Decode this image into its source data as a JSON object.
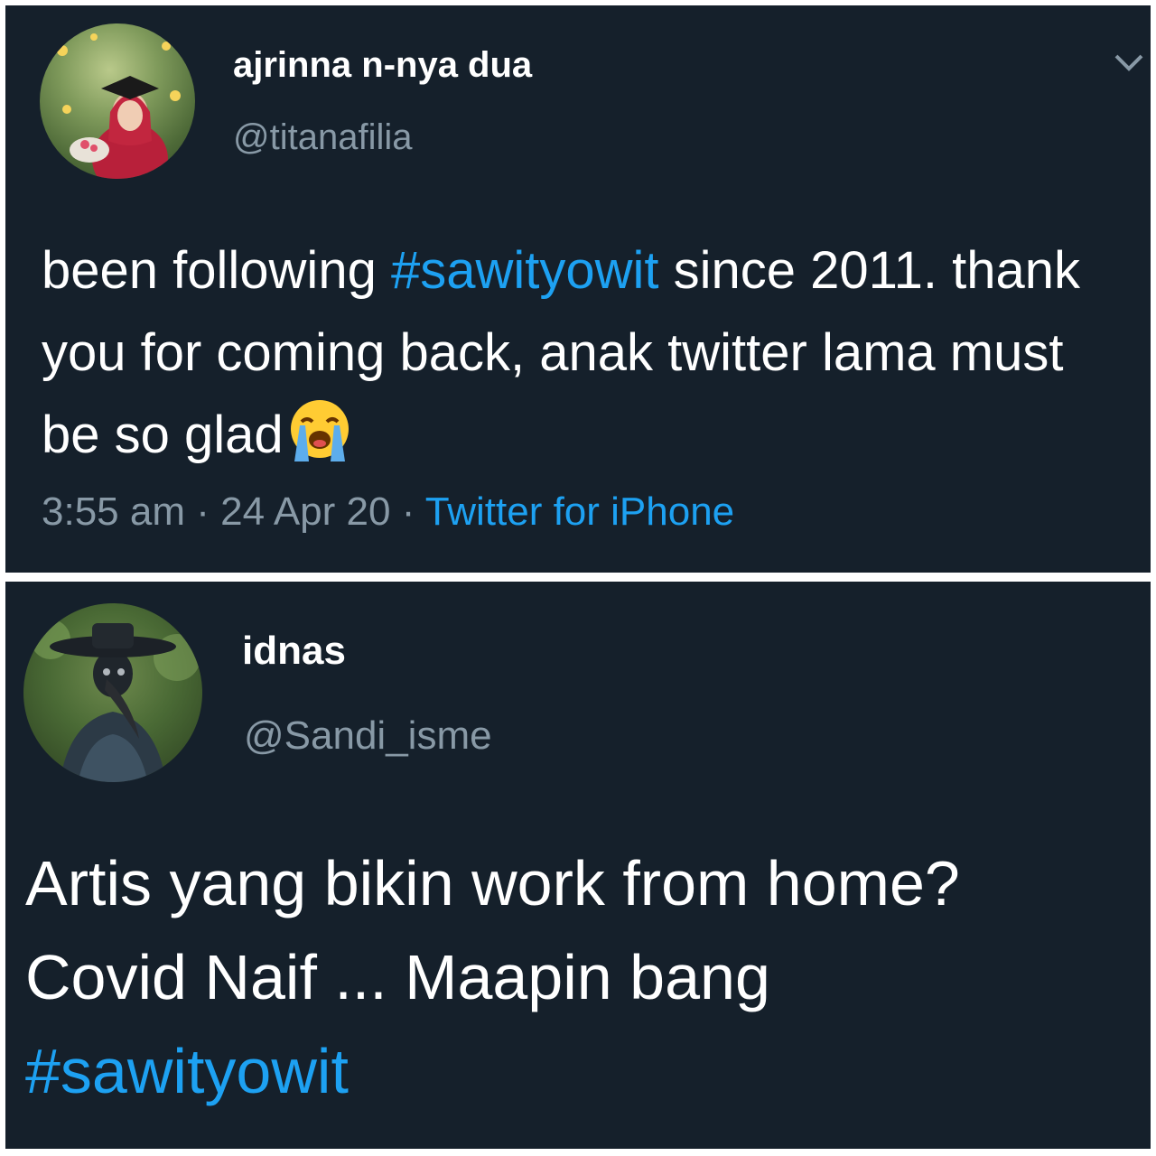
{
  "tweets": [
    {
      "display_name": "ajrinna n-nya dua",
      "handle": "@titanafilia",
      "text_before": "been following ",
      "hashtag": "#sawityowit",
      "text_after": " since 2011. thank you for coming back, anak twitter lama must be so glad",
      "emoji": "loudly-crying-face-icon",
      "time": "3:55 am",
      "sep1": " · ",
      "date": "24 Apr 20",
      "sep2": " · ",
      "source": "Twitter for iPhone"
    },
    {
      "display_name": "idnas",
      "handle": "@Sandi_isme",
      "line1": "Artis yang bikin work from home?",
      "line2": "Covid Naif ... Maapin bang",
      "hashtag": "#sawityowit"
    }
  ],
  "colors": {
    "background": "#15202b",
    "text": "#ffffff",
    "secondary": "#8899a6",
    "link": "#1da1f2"
  }
}
